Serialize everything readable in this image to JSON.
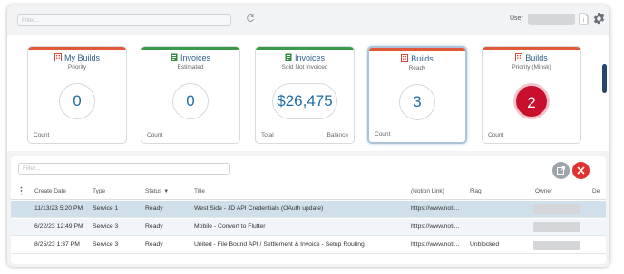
{
  "topbar": {
    "filter_placeholder": "Filter...",
    "user_label": "User"
  },
  "cards": [
    {
      "title": "My Builds",
      "subtitle": "Priority",
      "value": "0",
      "foot_left": "Count",
      "foot_right": "",
      "accent": "#e05a3a",
      "icon_color": "#d9463b"
    },
    {
      "title": "Invoices",
      "subtitle": "Estimated",
      "value": "0",
      "foot_left": "Count",
      "foot_right": "",
      "accent": "#3a9a4a",
      "icon_color": "#2e8b3e"
    },
    {
      "title": "Invoices",
      "subtitle": "Sold Not Invoiced",
      "value": "$26,475",
      "foot_left": "Total",
      "foot_right": "Balance",
      "accent": "#3a9a4a",
      "icon_color": "#2e8b3e"
    },
    {
      "title": "Builds",
      "subtitle": "Ready",
      "value": "3",
      "foot_left": "Count",
      "foot_right": "",
      "accent": "#e05a3a",
      "icon_color": "#d9463b"
    },
    {
      "title": "Builds",
      "subtitle": "Priority (Minsk)",
      "value": "2",
      "foot_left": "Count",
      "foot_right": "",
      "accent": "#e05a3a",
      "icon_color": "#d9463b"
    }
  ],
  "table": {
    "filter_placeholder": "Filter...",
    "columns": [
      "Create Date",
      "Type",
      "Status",
      "Title",
      "(Notion Link)",
      "Flag",
      "Owner",
      "De"
    ],
    "rows": [
      {
        "create_date": "11/13/23 5:20 PM",
        "type": "Service 1",
        "status": "Ready",
        "title": "West Side - JD API Credentials (OAuth update)",
        "notion_link": "https://www.noti...",
        "flag": ""
      },
      {
        "create_date": "6/22/23 12:49 PM",
        "type": "Service 3",
        "status": "Ready",
        "title": "Mobile - Convert to Flutter",
        "notion_link": "https://www.noti...",
        "flag": ""
      },
      {
        "create_date": "8/25/23 1:37 PM",
        "type": "Service 3",
        "status": "Ready",
        "title": "United - File Bound API / Settlement & Invoice - Setup Routing",
        "notion_link": "https://www.noti...",
        "flag": "Unblocked"
      }
    ]
  },
  "colors": {
    "accent_blue": "#1e6ca8",
    "danger_red": "#c8102e",
    "scroll_thumb": "#25476a",
    "selected_row": "#cfe0ea"
  }
}
